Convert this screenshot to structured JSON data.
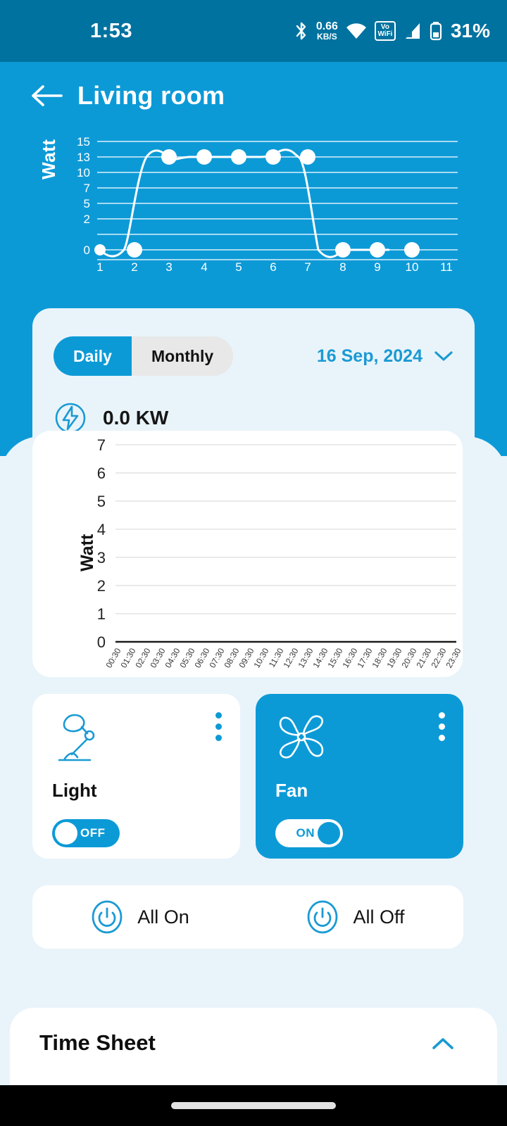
{
  "status_bar": {
    "time": "1:53",
    "net_rate_value": "0.66",
    "net_rate_unit": "KB/S",
    "vowifi_top": "Vo",
    "vowifi_bottom": "WiFi",
    "battery": "31%",
    "icons": [
      "bluetooth-icon",
      "wifi-icon",
      "vowifi-icon",
      "cellular-signal-icon",
      "battery-icon"
    ]
  },
  "header": {
    "back_icon": "back-arrow-icon",
    "title": "Living room"
  },
  "summary_chart": {
    "ylabel": "Watt"
  },
  "energy_card": {
    "tabs": [
      {
        "label": "Daily",
        "active": true
      },
      {
        "label": "Monthly",
        "active": false
      }
    ],
    "date": "16 Sep, 2024",
    "date_chevron_icon": "chevron-down-icon",
    "power_icon": "energy-bolt-icon",
    "power_value": "0.0 KW"
  },
  "detail_chart": {
    "ylabel": "Watt"
  },
  "devices": [
    {
      "name": "Light",
      "icon": "desk-lamp-icon",
      "menu_icon": "more-vertical-icon",
      "state": "OFF",
      "on": false
    },
    {
      "name": "Fan",
      "icon": "fan-icon",
      "menu_icon": "more-vertical-icon",
      "state": "ON",
      "on": true
    }
  ],
  "all_controls": [
    {
      "label": "All On",
      "icon": "power-icon"
    },
    {
      "label": "All Off",
      "icon": "power-icon"
    }
  ],
  "time_sheet": {
    "title": "Time Sheet",
    "chevron_icon": "chevron-up-icon"
  },
  "colors": {
    "status_bar_blue": "#00729f",
    "brand_blue": "#0c9ad7",
    "panel_bg": "#e9f4fa",
    "card_white": "#ffffff",
    "text_dark": "#121212",
    "nav_black": "#000000"
  },
  "chart_data": [
    {
      "type": "line",
      "title": "",
      "xlabel": "",
      "ylabel": "Watt",
      "categories": [
        "1",
        "2",
        "3",
        "4",
        "5",
        "6",
        "7",
        "8",
        "9",
        "10",
        "11"
      ],
      "x": [
        1,
        2,
        3,
        4,
        5,
        6,
        7,
        8,
        9,
        10
      ],
      "values": [
        0,
        0,
        13,
        13,
        13,
        13,
        13,
        0,
        0,
        0
      ],
      "ytick_labels": [
        "0",
        "2",
        "5",
        "7",
        "10",
        "13",
        "15"
      ],
      "ylim": [
        0,
        15
      ],
      "xlim": [
        1,
        11
      ],
      "grid": true,
      "legend": "none",
      "line_color": "#ffffff",
      "marker": "circle",
      "marker_color": "#ffffff",
      "background": "#0c9ad7"
    },
    {
      "type": "line",
      "title": "",
      "xlabel": "",
      "ylabel": "Watt",
      "categories": [
        "00:30",
        "01:30",
        "02:30",
        "03:30",
        "04:30",
        "05:30",
        "06:30",
        "07:30",
        "08:30",
        "09:30",
        "10:30",
        "11:30",
        "12:30",
        "13:30",
        "14:30",
        "15:30",
        "16:30",
        "17:30",
        "18:30",
        "19:30",
        "20:30",
        "21:30",
        "22:30",
        "23:30"
      ],
      "values": [],
      "ytick_labels": [
        "0",
        "1",
        "2",
        "3",
        "4",
        "5",
        "6",
        "7"
      ],
      "ylim": [
        0,
        7
      ],
      "grid": true,
      "legend": "none",
      "background": "#ffffff"
    }
  ]
}
